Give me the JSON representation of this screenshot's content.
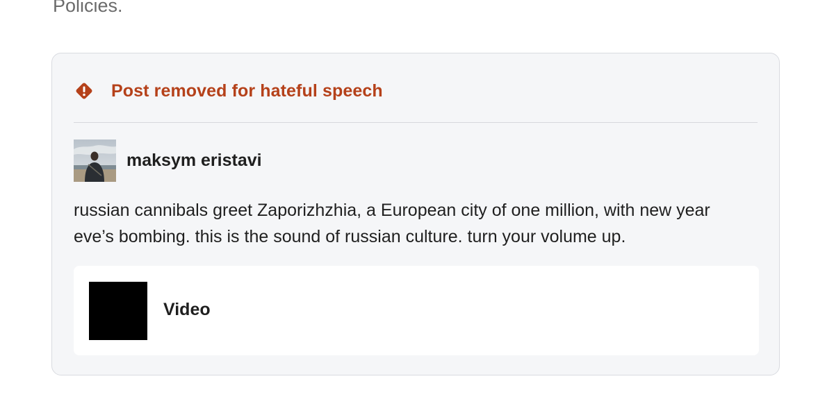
{
  "intro": {
    "text": "Policies."
  },
  "notice": {
    "title": "Post removed for hateful speech",
    "icon": "alert-diamond-icon",
    "accent_color": "#b5411a"
  },
  "post": {
    "author_name": "maksym eristavi",
    "avatar_icon": "avatar",
    "text": "russian cannibals greet Zaporizhzhia, a European city of one million, with new year eve’s bombing. this is the sound of russian culture. turn your volume up.",
    "media": {
      "label": "Video",
      "thumbnail_color": "#000000"
    }
  }
}
